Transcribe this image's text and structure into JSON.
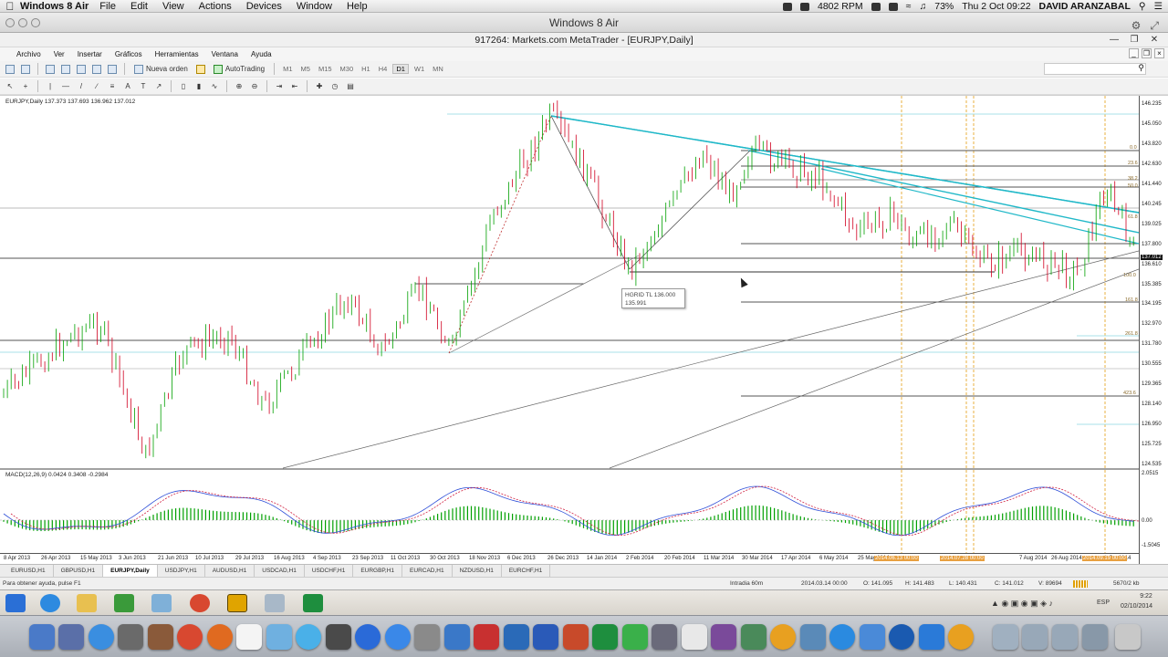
{
  "mac_menubar": {
    "app_name": "Windows 8 Air",
    "menus": [
      "File",
      "Edit",
      "View",
      "Actions",
      "Devices",
      "Window",
      "Help"
    ],
    "fan": "4802 RPM",
    "battery": "73%",
    "datetime": "Thu 2 Oct  09:22",
    "user": "DAVID ARANZABAL"
  },
  "vm_window": {
    "title": "Windows 8 Air"
  },
  "mt_window": {
    "title": "917264: Markets.com MetaTrader - [EURJPY,Daily]",
    "menus": [
      "Archivo",
      "Ver",
      "Insertar",
      "Gráficos",
      "Herramientas",
      "Ventana",
      "Ayuda"
    ]
  },
  "toolbar1": {
    "new_order": "Nueva orden",
    "autotrading": "AutoTrading",
    "timeframes": [
      "M1",
      "M5",
      "M15",
      "M30",
      "H1",
      "H4",
      "D1",
      "W1",
      "MN"
    ],
    "active_timeframe": "D1"
  },
  "chart": {
    "header": "EURJPY,Daily  137.373 137.693 136.962 137.012",
    "macd_header": "MACD(12,26,9) 0.0424 0.3408 -0.2984",
    "tooltip_line1": "HGRID TL 136.000",
    "tooltip_line2": "135.991",
    "current_price": "137.012",
    "price_ticks": [
      "146.235",
      "145.050",
      "143.820",
      "142.630",
      "141.440",
      "140.245",
      "139.025",
      "137.800",
      "136.610",
      "135.385",
      "134.195",
      "132.970",
      "131.780",
      "130.555",
      "129.365",
      "128.140",
      "126.950",
      "125.725",
      "124.535"
    ],
    "macd_ticks": [
      "2.0515",
      "0.00",
      "-1.5045"
    ],
    "date_ticks": [
      "8 Apr 2013",
      "26 Apr 2013",
      "15 May 2013",
      "3 Jun 2013",
      "21 Jun 2013",
      "10 Jul 2013",
      "29 Jul 2013",
      "16 Aug 2013",
      "4 Sep 2013",
      "23 Sep 2013",
      "11 Oct 2013",
      "30 Oct 2013",
      "18 Nov 2013",
      "6 Dec 2013",
      "26 Dec 2013",
      "14 Jan 2014",
      "2 Feb 2014",
      "20 Feb 2014",
      "11 Mar 2014",
      "30 Mar 2014",
      "17 Apr 2014",
      "6 May 2014",
      "25 May 2014",
      "7 Aug 2014",
      "26 Aug 2014",
      "2 Oct 2014"
    ],
    "date_highlights": [
      "2014.06.13 00:00",
      "2014.07.28 00:00",
      "2014.09.19 00:00"
    ],
    "fib_labels": [
      "0.0",
      "23.6",
      "38.2",
      "50.0",
      "61.8",
      "100.0",
      "161.8",
      "261.8",
      "423.6"
    ],
    "colors": {
      "bull": "#00a000",
      "bear": "#d00020",
      "trendline": "#20b8c8",
      "fib": "#a8e0e8",
      "vline": "#e8b040"
    }
  },
  "tabs": {
    "items": [
      "EURUSD,H1",
      "GBPUSD,H1",
      "EURJPY,Daily",
      "USDJPY,H1",
      "AUDUSD,H1",
      "USDCAD,H1",
      "USDCHF,H1",
      "EURGBP,H1",
      "EURCAD,H1",
      "NZDUSD,H1",
      "EURCHF,H1"
    ],
    "active": "EURJPY,Daily"
  },
  "status": {
    "help": "Para obtener ayuda, pulse F1",
    "profile": "Intradia 60m",
    "time": "2014.03.14 00:00",
    "open": "O: 141.095",
    "high": "H: 141.483",
    "low": "L: 140.431",
    "close": "C: 141.012",
    "volume": "V: 89694",
    "traffic": "5670/2 kb"
  },
  "taskbar": {
    "lang": "ESP",
    "time": "9:22",
    "date": "02/10/2014"
  }
}
